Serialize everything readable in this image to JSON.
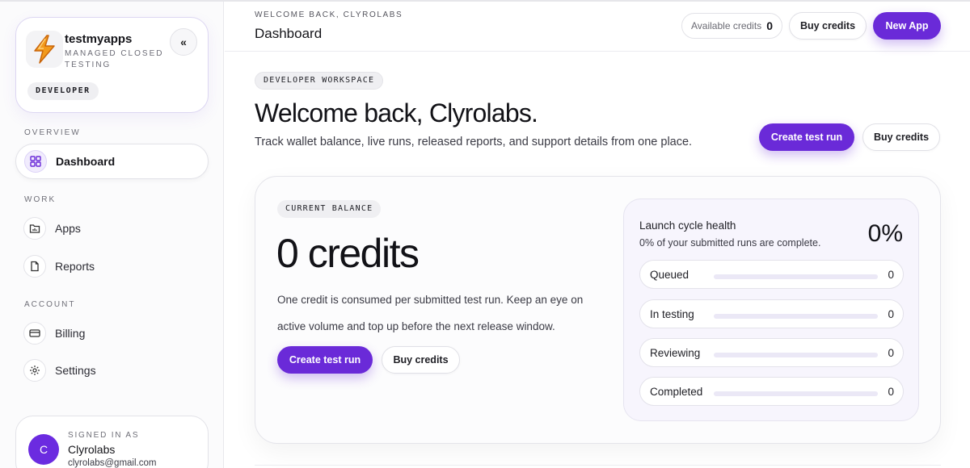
{
  "sidebar": {
    "brand": {
      "title": "testmyapps",
      "subtitle": "MANAGED CLOSED TESTING",
      "role": "DEVELOPER",
      "logo_icon": "lightning-bolt-icon",
      "collapse_icon": "double-chevron-left-icon",
      "collapse_glyph": "«"
    },
    "sections": {
      "overview": "OVERVIEW",
      "work": "WORK",
      "account": "ACCOUNT"
    },
    "items": [
      {
        "label": "Dashboard",
        "icon": "grid-icon",
        "active": true
      },
      {
        "label": "Apps",
        "icon": "folder-icon",
        "active": false
      },
      {
        "label": "Reports",
        "icon": "document-icon",
        "active": false
      },
      {
        "label": "Billing",
        "icon": "credit-card-icon",
        "active": false
      },
      {
        "label": "Settings",
        "icon": "gear-icon",
        "active": false
      }
    ],
    "user": {
      "label": "SIGNED IN AS",
      "name": "Clyrolabs",
      "email": "clyrolabs@gmail.com",
      "initial": "C"
    }
  },
  "header": {
    "eyebrow": "WELCOME BACK, CLYROLABS",
    "title": "Dashboard",
    "credits_label": "Available credits",
    "credits_value": "0",
    "buy_credits": "Buy credits",
    "new_app": "New App"
  },
  "main": {
    "workspace_badge": "DEVELOPER WORKSPACE",
    "welcome": "Welcome back, Clyrolabs.",
    "subtitle": "Track wallet balance, live runs, released reports, and support details from one place.",
    "create_test_run": "Create test run",
    "buy_credits": "Buy credits",
    "balance": {
      "badge": "CURRENT BALANCE",
      "amount": "0 credits",
      "description": "One credit is consumed per submitted test run. Keep an eye on active volume and top up before the next release window.",
      "create_test_run": "Create test run",
      "buy_credits": "Buy credits"
    },
    "health": {
      "title": "Launch cycle health",
      "subtitle": "0% of your submitted runs are complete.",
      "percent": "0%",
      "stats": [
        {
          "label": "Queued",
          "value": "0",
          "progress": 0
        },
        {
          "label": "In testing",
          "value": "0",
          "progress": 0
        },
        {
          "label": "Reviewing",
          "value": "0",
          "progress": 0
        },
        {
          "label": "Completed",
          "value": "0",
          "progress": 0
        }
      ]
    }
  },
  "colors": {
    "accent": "#6a2ad8",
    "avatar": "#6b2be0"
  }
}
